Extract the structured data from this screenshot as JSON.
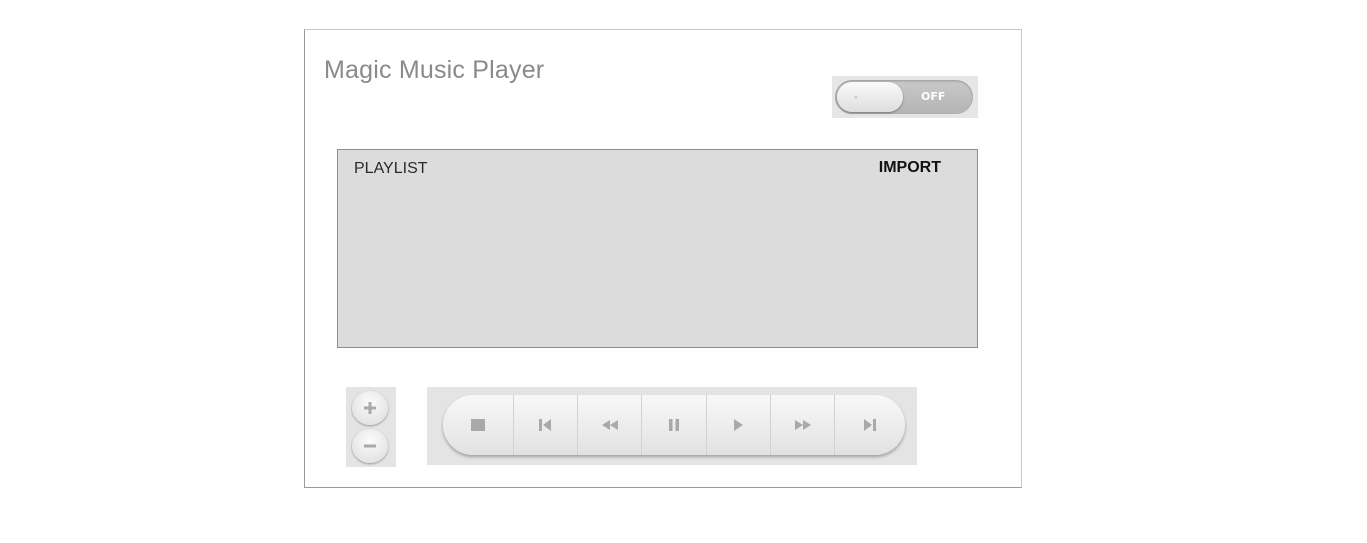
{
  "app": {
    "title": "Magic Music Player"
  },
  "power_toggle": {
    "state": "OFF"
  },
  "playlist": {
    "label": "PLAYLIST",
    "import_label": "IMPORT",
    "items": []
  },
  "volume": {
    "up_icon": "plus-icon",
    "down_icon": "minus-icon"
  },
  "transport": {
    "buttons": [
      "stop",
      "previous",
      "rewind",
      "pause",
      "play",
      "fast-forward",
      "next"
    ]
  },
  "colors": {
    "icon_gray": "#a9a9a9",
    "playlist_bg": "#dddcdc",
    "title_gray": "#8a8a8a"
  }
}
